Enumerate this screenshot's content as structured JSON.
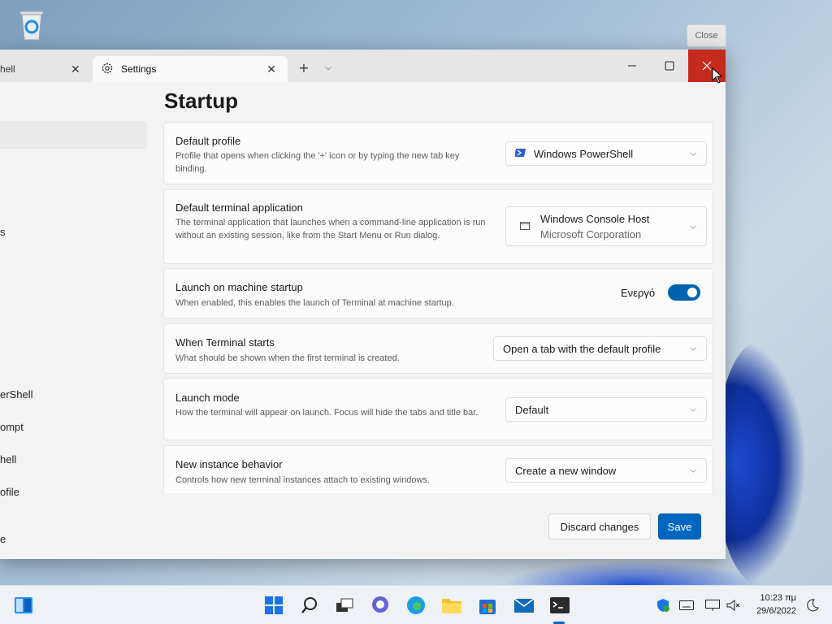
{
  "desktop": {
    "recycle_bin_icon": "recycle-bin-icon",
    "close_tooltip": "Close"
  },
  "window": {
    "tabs": [
      {
        "label": "hell",
        "icon": "powershell-icon",
        "active": false
      },
      {
        "label": "Settings",
        "icon": "gear-icon",
        "active": true
      }
    ],
    "new_tab_glyph": "+",
    "nav_fragments": [
      "s",
      "erShell",
      "ompt",
      "hell",
      "ofile",
      "e"
    ]
  },
  "page": {
    "title": "Startup",
    "cards": [
      {
        "title": "Default profile",
        "desc": "Profile that opens when clicking the '+' icon or by typing the new tab key binding.",
        "value": "Windows PowerShell"
      },
      {
        "title": "Default terminal application",
        "desc": "The terminal application that launches when a command-line application is run without an existing session, like from the Start Menu or Run dialog.",
        "value": "Windows Console Host",
        "value_sub": "Microsoft Corporation"
      },
      {
        "title": "Launch on machine startup",
        "desc": "When enabled, this enables the launch of Terminal at machine startup.",
        "toggle_label": "Ενεργό",
        "toggle_on": true
      },
      {
        "title": "When Terminal starts",
        "desc": "What should be shown when the first terminal is created.",
        "value": "Open a tab with the default profile"
      },
      {
        "title": "Launch mode",
        "desc": "How the terminal will appear on launch. Focus will hide the tabs and title bar.",
        "value": "Default"
      },
      {
        "title": "New instance behavior",
        "desc": "Controls how new terminal instances attach to existing windows.",
        "value": "Create a new window"
      }
    ],
    "discard_label": "Discard changes",
    "save_label": "Save"
  },
  "taskbar": {
    "time": "10:23 πμ",
    "date": "29/6/2022"
  },
  "colors": {
    "accent": "#0067c0",
    "close_red": "#c42b1c"
  }
}
